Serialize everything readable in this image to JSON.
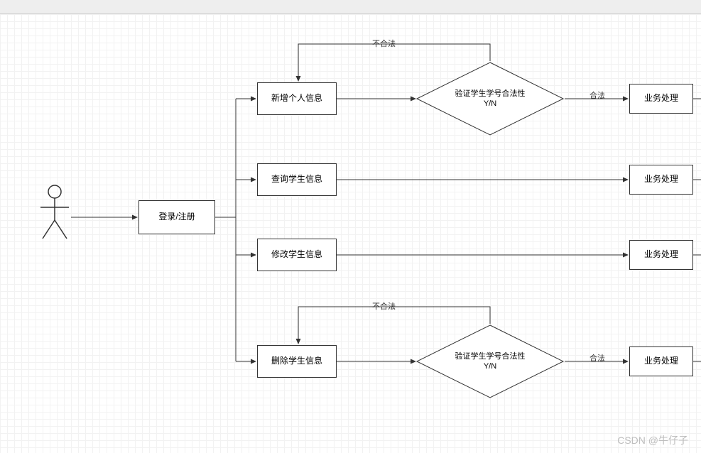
{
  "toolbar": {},
  "actor": {
    "name": "actor"
  },
  "nodes": {
    "login": {
      "label": "登录/注册"
    },
    "add": {
      "label": "新增个人信息"
    },
    "query": {
      "label": "查询学生信息"
    },
    "modify": {
      "label": "修改学生信息"
    },
    "delete": {
      "label": "删除学生信息"
    },
    "verify1": {
      "label": "验证学生学号合法性\nY/N"
    },
    "verify2": {
      "label": "验证学生学号合法性\nY/N"
    },
    "proc1": {
      "label": "业务处理"
    },
    "proc2": {
      "label": "业务处理"
    },
    "proc3": {
      "label": "业务处理"
    },
    "proc4": {
      "label": "业务处理"
    }
  },
  "edgeLabels": {
    "illegal1": "不合法",
    "legal1": "合法",
    "illegal2": "不合法",
    "legal2": "合法"
  },
  "watermark": "CSDN @牛仔子"
}
